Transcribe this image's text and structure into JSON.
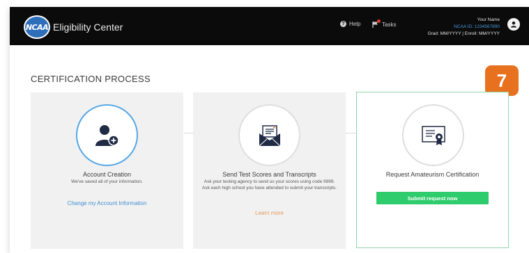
{
  "header": {
    "logo_text": "NCAA",
    "brand": "Eligibility Center",
    "help_label": "Help",
    "tasks_label": "Tasks",
    "user_name": "Your Name",
    "ncaa_id": "NCAA ID: 1234567890",
    "grad_enroll": "Grad: MM/YYYY | Enroll: MM/YYYY"
  },
  "page": {
    "title": "CERTIFICATION PROCESS",
    "step_badge": "7"
  },
  "steps": [
    {
      "icon": "add-user-icon",
      "title": "Account Creation",
      "description": "We've saved all of your information.",
      "link": "Change my Account Information",
      "state": "completed"
    },
    {
      "icon": "envelope-icon",
      "title": "Send Test Scores and Transcripts",
      "description": "Ask your testing agency to send us your scores using code 9999. Ask each high school you have attended to submit your transcripts.",
      "link": "Learn more",
      "state": "inactive"
    },
    {
      "icon": "certificate-icon",
      "title": "Request Amateurism Certification",
      "button": "Submit request now",
      "state": "current"
    }
  ],
  "colors": {
    "navbar": "#0b0b0b",
    "accent_blue": "#3f8fd2",
    "orange": "#e8711f",
    "green": "#2ecc6c"
  }
}
